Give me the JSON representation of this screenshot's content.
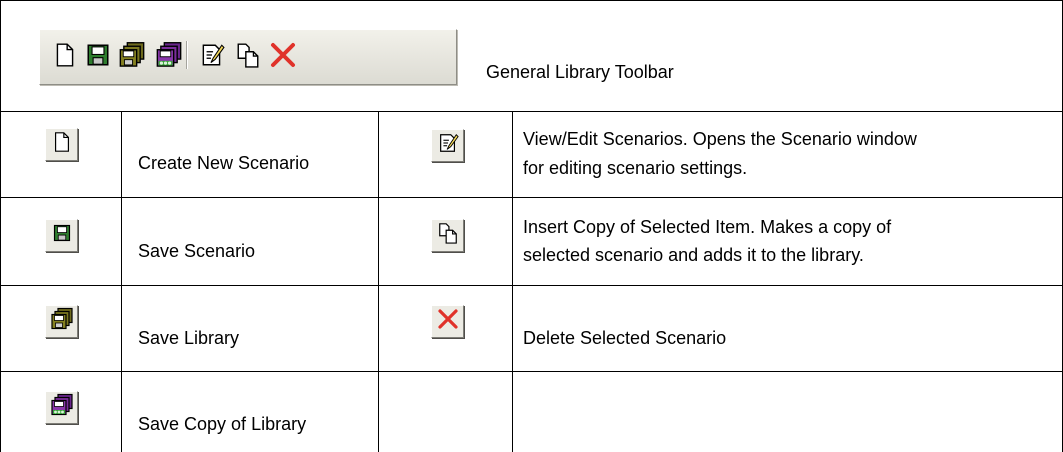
{
  "toolbar": {
    "caption": "General Library Toolbar",
    "icons": [
      "new-document-icon",
      "save-icon",
      "save-library-icon",
      "save-copy-library-icon",
      "edit-icon",
      "copy-icon",
      "delete-icon"
    ]
  },
  "rows": [
    {
      "icon": "new-document-icon",
      "label": "Create New Scenario"
    },
    {
      "icon": "save-icon",
      "label": "Save Scenario"
    },
    {
      "icon": "save-library-icon",
      "label": "Save Library"
    },
    {
      "icon": "save-copy-library-icon",
      "label": "Save Copy of Library"
    }
  ],
  "right_rows": [
    {
      "icon": "edit-icon",
      "line1": "View/Edit Scenarios.  Opens the Scenario window",
      "line2": "for editing scenario settings."
    },
    {
      "icon": "copy-icon",
      "line1": "Insert Copy of Selected Item.  Makes a copy of",
      "line2": "selected scenario and adds it to the library."
    },
    {
      "icon": "delete-icon",
      "line1": "Delete Selected Scenario",
      "line2": ""
    }
  ],
  "colors": {
    "delete_red": "#e0322a",
    "save_green": "#2e7d2e",
    "library_olive": "#6f6b1d",
    "library_purple": "#7a2d9a"
  }
}
